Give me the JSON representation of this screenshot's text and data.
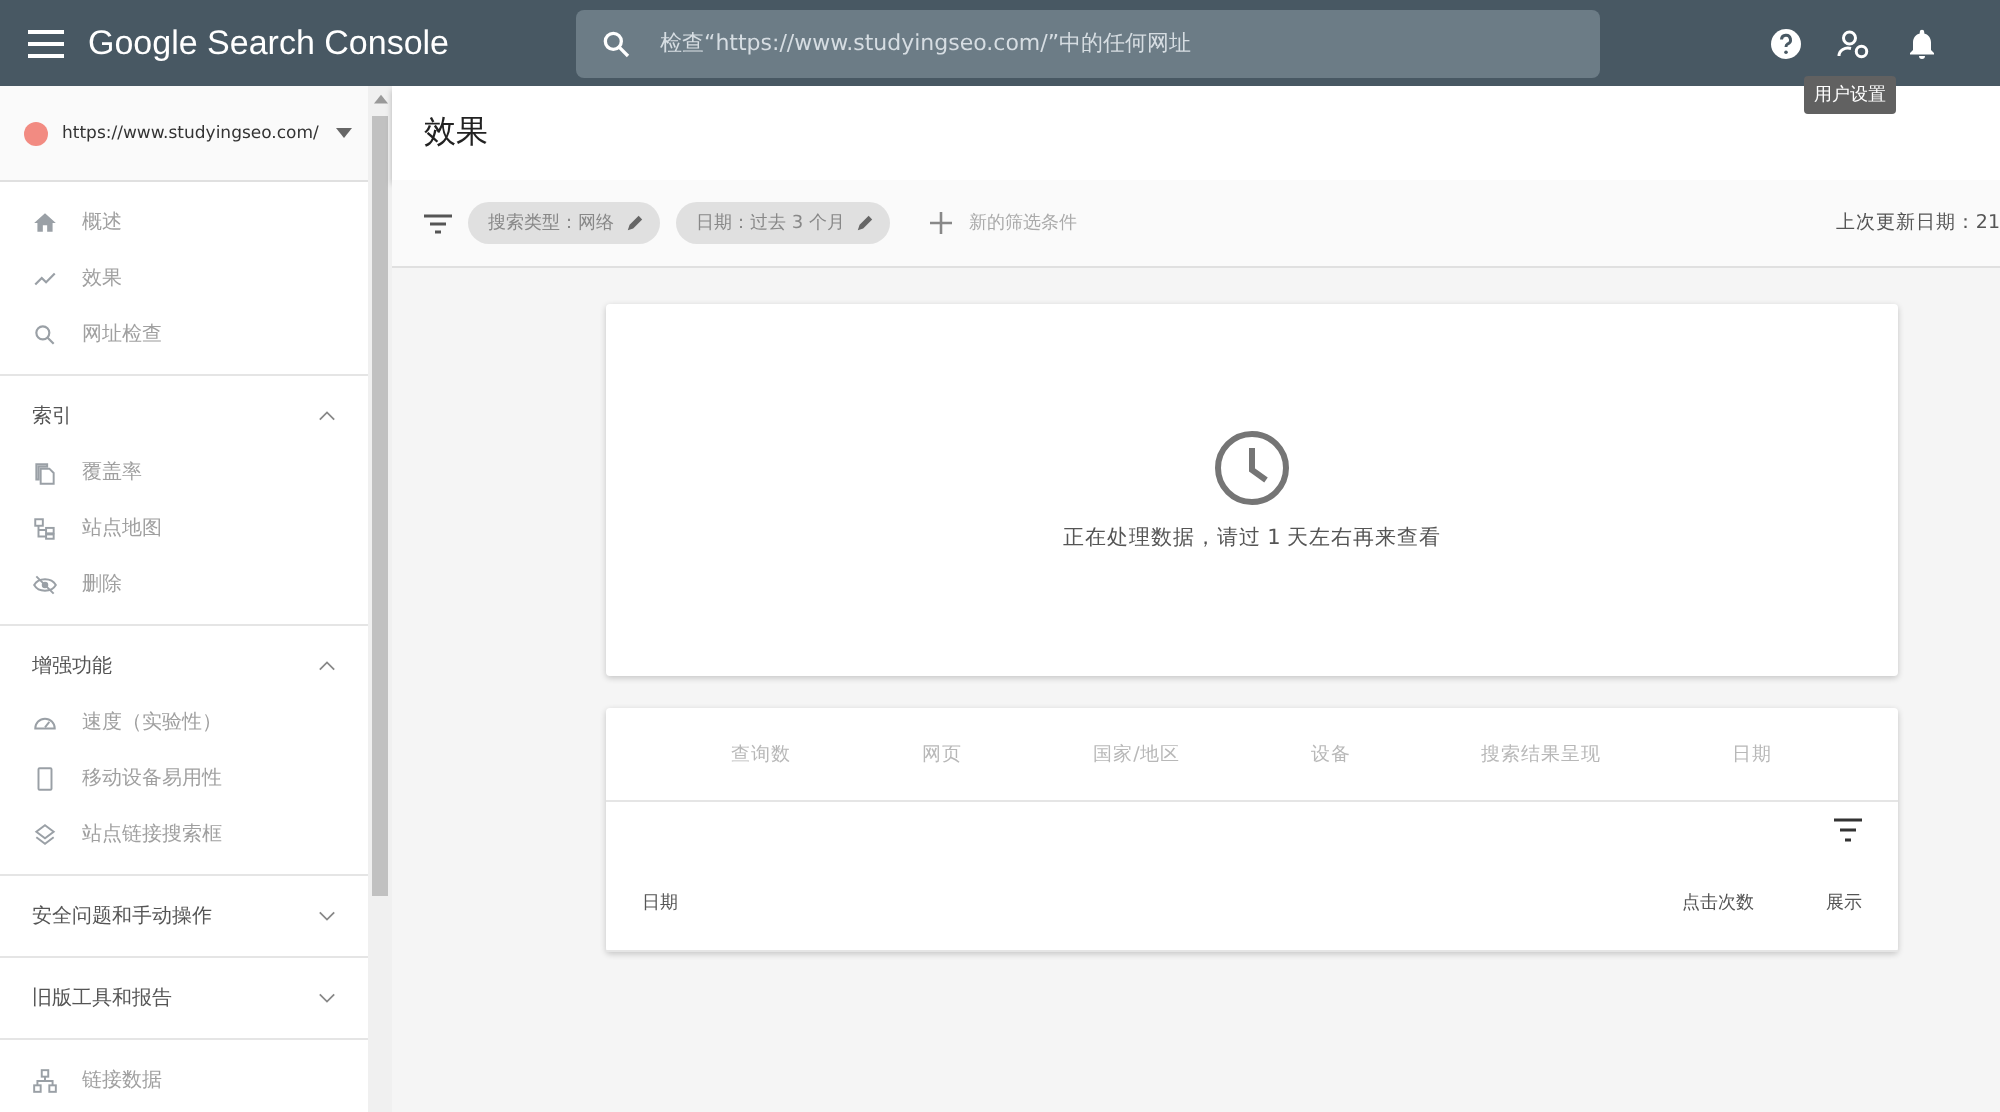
{
  "header": {
    "title": "Google Search Console",
    "search": {
      "placeholder": "检查“https://www.studyingseo.com/”中的任何网址"
    },
    "tooltip": "用户设置"
  },
  "property": {
    "url": "https://www.studyingseo.com/"
  },
  "sidebar": {
    "items": [
      {
        "label": "概述"
      },
      {
        "label": "效果"
      },
      {
        "label": "网址检查"
      }
    ],
    "sections": [
      {
        "label": "索引",
        "expanded": true,
        "items": [
          {
            "label": "覆盖率"
          },
          {
            "label": "站点地图"
          },
          {
            "label": "删除"
          }
        ]
      },
      {
        "label": "增强功能",
        "expanded": true,
        "items": [
          {
            "label": "速度（实验性）"
          },
          {
            "label": "移动设备易用性"
          },
          {
            "label": "站点链接搜索框"
          }
        ]
      },
      {
        "label": "安全问题和手动操作",
        "expanded": false
      },
      {
        "label": "旧版工具和报告",
        "expanded": false
      }
    ],
    "footer_items": [
      {
        "label": "链接数据"
      }
    ]
  },
  "page": {
    "title": "效果"
  },
  "filters": {
    "chips": [
      "搜索类型：网络",
      "日期：过去 3 个月"
    ],
    "add_label": "新的筛选条件",
    "last_updated": "上次更新日期：21"
  },
  "status_card": {
    "message": "正在处理数据，请过 1 天左右再来查看"
  },
  "table": {
    "tabs": [
      "查询数",
      "网页",
      "国家/地区",
      "设备",
      "搜索结果呈现",
      "日期"
    ],
    "columns": [
      "日期",
      "点击次数",
      "展示"
    ]
  }
}
